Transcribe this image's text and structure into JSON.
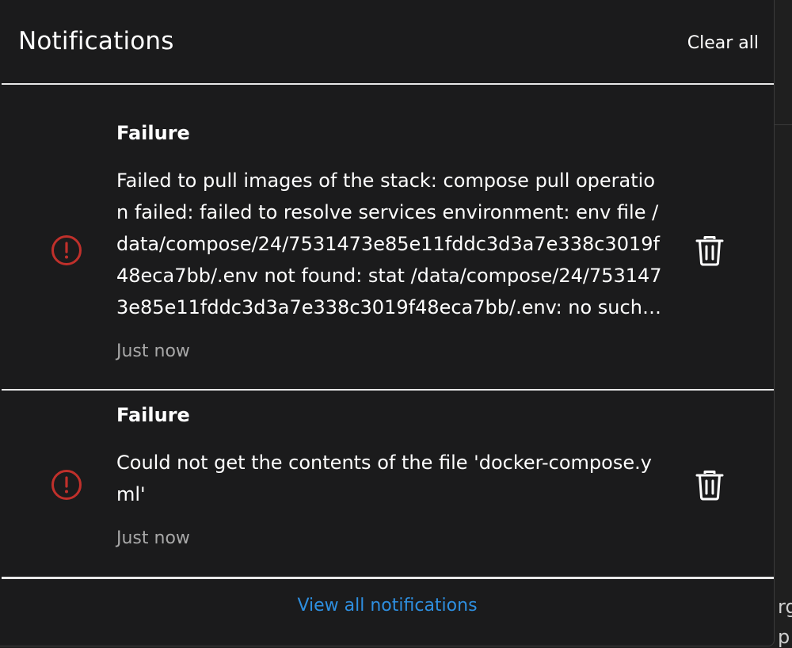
{
  "header": {
    "title": "Notifications",
    "clear_all_label": "Clear all"
  },
  "notifications": [
    {
      "title": "Failure",
      "message": "Failed to pull images of the stack: compose pull operation failed: failed to resolve services environment: env file /data/compose/24/7531473e85e11fddc3d3a7e338c3019f48eca7bb/.env not found: stat /data/compose/24/7531473e85e11fddc3d3a7e338c3019f48eca7bb/.env: no such file or directory",
      "time": "Just now",
      "status": "error"
    },
    {
      "title": "Failure",
      "message": "Could not get the contents of the file 'docker-compose.yml'",
      "time": "Just now",
      "status": "error"
    }
  ],
  "footer": {
    "view_all_label": "View all notifications"
  },
  "background": {
    "fragment_top": "rg",
    "fragment_bottom": "p"
  },
  "colors": {
    "panel_bg": "#1b1b1c",
    "error": "#c0302b",
    "link": "#2e8fe0",
    "muted": "#a8a8a8"
  },
  "icons": {
    "status": "alert-circle-icon",
    "delete": "trash-icon"
  }
}
